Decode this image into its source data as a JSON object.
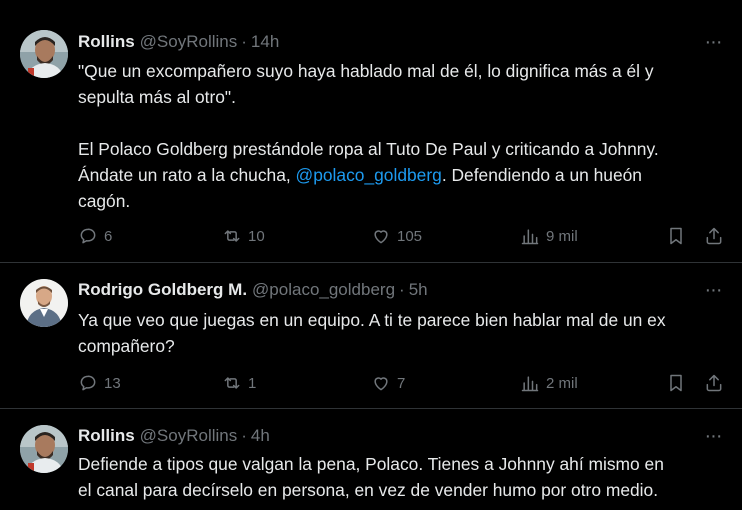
{
  "tweets": [
    {
      "author": {
        "name": "Rollins",
        "handle": "@SoyRollins",
        "time": "14h"
      },
      "more_label": "···",
      "lines": [
        "\"Que un excompañero suyo haya hablado mal de él, lo dignifica más a él y",
        "sepulta más al otro\"."
      ],
      "para2": {
        "line1": "El Polaco Goldberg prestándole ropa al Tuto De Paul y criticando a Johnny.",
        "line2_pre": "Ándate un rato a la chucha, ",
        "mention": "@polaco_goldberg",
        "line2_post": ". Defendiendo a un hueón",
        "line3": "cagón."
      },
      "stats": {
        "replies": "6",
        "retweets": "10",
        "likes": "105",
        "views": "9 mil"
      }
    },
    {
      "author": {
        "name": "Rodrigo Goldberg M.",
        "handle": "@polaco_goldberg",
        "time": "5h"
      },
      "more_label": "···",
      "lines": [
        "Ya que veo que juegas en un equipo. A ti te parece bien hablar mal de un ex",
        "compañero?"
      ],
      "stats": {
        "replies": "13",
        "retweets": "1",
        "likes": "7",
        "views": "2 mil"
      }
    },
    {
      "author": {
        "name": "Rollins",
        "handle": "@SoyRollins",
        "time": "4h"
      },
      "more_label": "···",
      "lines": [
        "Defiende a tipos que valgan la pena, Polaco. Tienes a Johnny ahí mismo en",
        "el canal para decírselo en persona, en vez de vender humo por otro medio."
      ]
    }
  ],
  "separator": "·",
  "colors": {
    "background": "#000000",
    "text": "#e7e9ea",
    "muted": "#71767b",
    "link": "#1d9bf0",
    "divider": "#2f3336"
  }
}
